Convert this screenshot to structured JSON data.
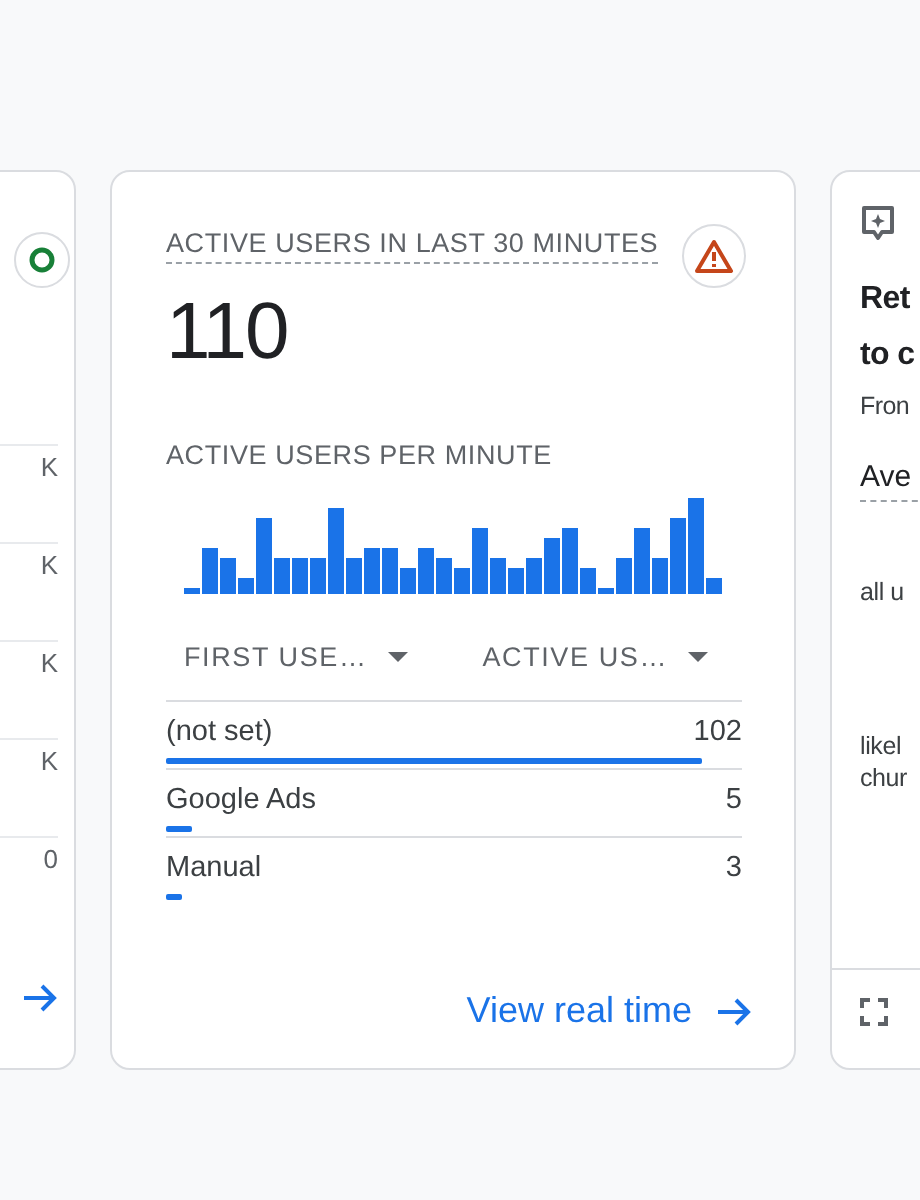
{
  "left_card": {
    "axis_labels": [
      "K",
      "K",
      "K",
      "K",
      "0"
    ]
  },
  "realtime_card": {
    "title": "ACTIVE USERS IN LAST 30 MINUTES",
    "value": "110",
    "chart_title": "ACTIVE USERS PER MINUTE",
    "columns": [
      "FIRST USE…",
      "ACTIVE US…"
    ],
    "rows": [
      {
        "name": "(not set)",
        "value": "102",
        "level": 0.93
      },
      {
        "name": "Google Ads",
        "value": "5",
        "level": 0.045
      },
      {
        "name": "Manual",
        "value": "3",
        "level": 0.027
      }
    ],
    "link": "View real time"
  },
  "right_card": {
    "title_lines": [
      "Ret",
      "to c"
    ],
    "subtitle": "Fron",
    "metric": "Ave",
    "labels": [
      "all u"
    ],
    "label_lines": [
      "likel",
      "chur"
    ]
  }
}
